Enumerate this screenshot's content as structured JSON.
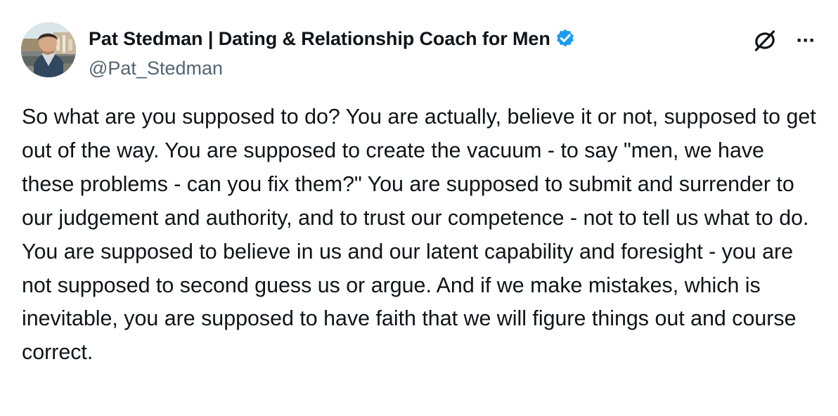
{
  "post": {
    "author": {
      "display_name": "Pat Stedman | Dating & Relationship Coach for Men",
      "handle": "@Pat_Stedman",
      "verified_icon": "verified-badge-icon"
    },
    "actions": {
      "grok_icon": "grok-icon",
      "more_label": "···"
    },
    "text": "So what are you supposed to do? You are actually, believe it or not, supposed to get out of the way. You are supposed to create the vacuum - to say \"men, we have these problems - can you fix them?\" You are supposed to submit and surrender to our judgement and authority, and to trust our competence - not to tell us what to do. You are supposed to believe in us and our latent capability and foresight - you are not supposed to second guess us or argue. And if we make mistakes, which is inevitable, you are supposed to have faith that we will figure things out and course correct."
  },
  "theme": {
    "background": "#ffffff",
    "text": "#0f1419",
    "muted": "#536471",
    "verified": "#1d9bf0"
  }
}
